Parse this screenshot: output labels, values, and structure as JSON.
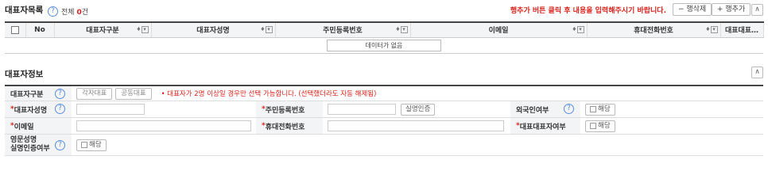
{
  "list": {
    "title": "대표자목록",
    "count_label": "전체",
    "count_value": "0",
    "count_unit": "건",
    "notice": "행추가 버튼 클릭 후 내용을 입력해주시기 바랍니다.",
    "delete_row": "− 행삭제",
    "add_row": "+ 행추가",
    "collapse_icon": "∧",
    "columns": [
      "No",
      "대표자구분",
      "대표자성명",
      "주민등록번호",
      "이메일",
      "휴대전화번호",
      "대표대표…"
    ],
    "sort_glyph": "♦",
    "filter_glyph": "▾",
    "empty_text": "데이터가 없음"
  },
  "info": {
    "title": "대표자정보",
    "collapse_icon": "∧",
    "help_glyph": "?",
    "req_mark": "*",
    "row1": {
      "label": "대표자구분",
      "option_individual": "각자대표",
      "option_joint": "공동대표",
      "note": "• 대표자가 2명 이상일 경우만 선택 가능합니다. (선택했더라도 자동 해제됨)"
    },
    "row2": {
      "name_label": "대표자성명",
      "rrn_label": "주민등록번호",
      "verify_button": "실명인증",
      "foreigner_label": "외국인여부",
      "foreigner_check": "해당"
    },
    "row3": {
      "email_label": "이메일",
      "mobile_label": "휴대전화번호",
      "rep_label": "대표대표자여부",
      "rep_check": "해당"
    },
    "row4": {
      "eng_label_line1": "영문성명",
      "eng_label_line2": "실명인증여부",
      "eng_check": "해당"
    }
  }
}
